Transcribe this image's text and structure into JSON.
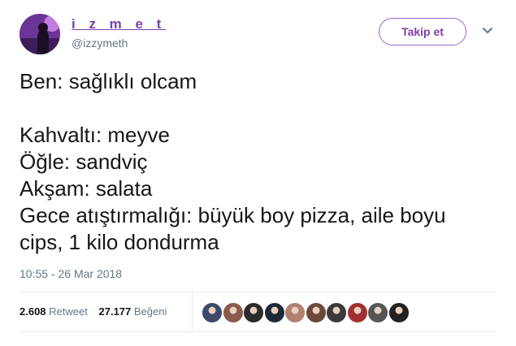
{
  "user": {
    "display_name": "i z m e t",
    "handle": "@izzymeth",
    "avatar_icon": "profile-photo",
    "accent_color": "#7b3fa8"
  },
  "follow_button": {
    "label": "Takip et"
  },
  "menu": {
    "icon": "chevron-down-icon"
  },
  "tweet": {
    "lines": [
      "Ben: sağlıklı olcam",
      "",
      "Kahvaltı: meyve",
      "Öğle: sandviç",
      "Akşam: salata",
      "Gece atıştırmalığı: büyük boy pizza, aile boyu",
      "cips, 1 kilo dondurma"
    ],
    "timestamp": "10:55 - 26 Mar 2018"
  },
  "stats": {
    "retweets_count": "2.608",
    "retweets_label": "Retweet",
    "likes_count": "27.177",
    "likes_label": "Beğeni"
  },
  "likers": [
    {
      "icon": "liker-avatar-1",
      "color": "#3d4a6b"
    },
    {
      "icon": "liker-avatar-2",
      "color": "#8a5a4a"
    },
    {
      "icon": "liker-avatar-3",
      "color": "#2b2b2b"
    },
    {
      "icon": "liker-avatar-4",
      "color": "#1e2a3a"
    },
    {
      "icon": "liker-avatar-5",
      "color": "#b08070"
    },
    {
      "icon": "liker-avatar-6",
      "color": "#6b4a3a"
    },
    {
      "icon": "liker-avatar-7",
      "color": "#3a3a3a"
    },
    {
      "icon": "liker-avatar-8",
      "color": "#a03030"
    },
    {
      "icon": "liker-avatar-9",
      "color": "#555555"
    },
    {
      "icon": "liker-avatar-10",
      "color": "#222222"
    }
  ]
}
